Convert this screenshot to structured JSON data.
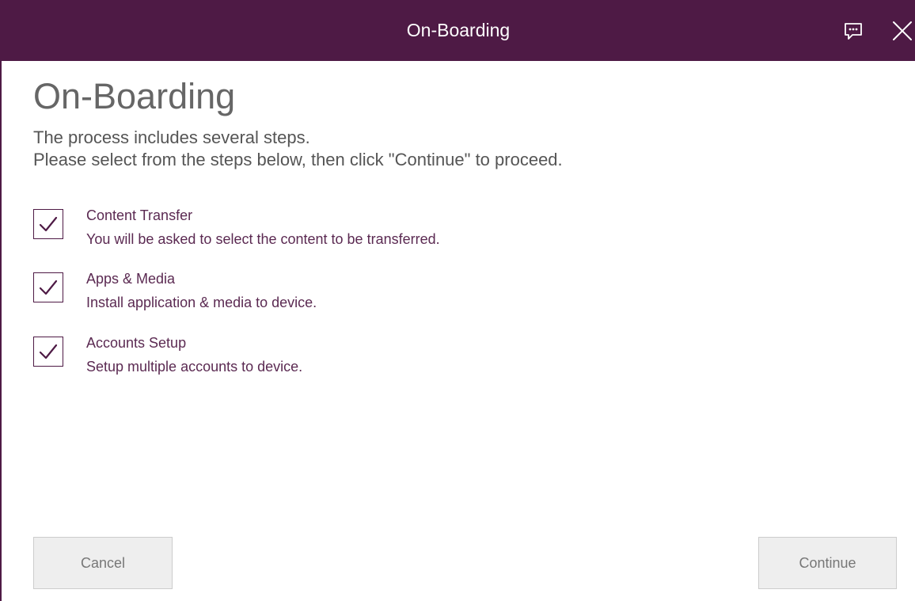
{
  "window": {
    "title": "On-Boarding",
    "colors": {
      "titlebar": "#4e1a45",
      "accent": "#5b2a52"
    },
    "icons": {
      "feedback": "feedback-icon",
      "close": "close-icon"
    }
  },
  "main": {
    "heading": "On-Boarding",
    "intro_line1": "The process includes several steps.",
    "intro_line2": "Please select from the steps below, then click \"Continue\" to proceed.",
    "steps": [
      {
        "title": "Content Transfer",
        "description": "You will be asked to select the content to be transferred.",
        "checked": true
      },
      {
        "title": "Apps & Media",
        "description": "Install application & media to device.",
        "checked": true
      },
      {
        "title": "Accounts Setup",
        "description": "Setup multiple accounts to device.",
        "checked": true
      }
    ]
  },
  "footer": {
    "cancel_label": "Cancel",
    "continue_label": "Continue"
  }
}
